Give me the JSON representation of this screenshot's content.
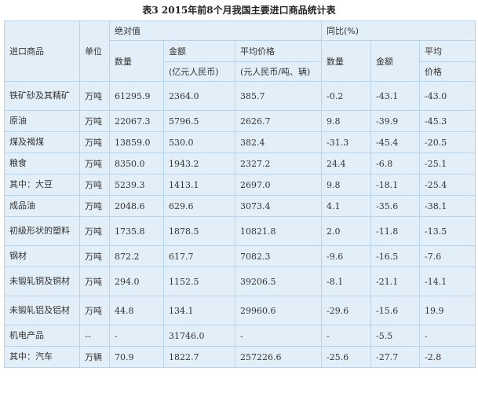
{
  "title": "表3 2015年前8个月我国主要进口商品统计表",
  "header": {
    "commodity": "进口商品",
    "unit": "单位",
    "absolute": "绝对值",
    "yoy": "同比(%)",
    "qty": "数量",
    "amount": "金额",
    "amount_unit": "(亿元人民币)",
    "avg_price": "平均价格",
    "avg_price_unit": "(元人民币/吨、辆)",
    "yoy_qty": "数量",
    "yoy_amount": "金额",
    "yoy_avg_1": "平均",
    "yoy_avg_2": "价格"
  },
  "rows": [
    {
      "name": "铁矿砂及其精矿",
      "unit": "万吨",
      "qty": "61295.9",
      "amount": "2364.0",
      "price": "385.7",
      "yoy_qty": "-0.2",
      "yoy_amount": "-43.1",
      "yoy_price": "-43.0"
    },
    {
      "name": "原油",
      "unit": "万吨",
      "qty": "22067.3",
      "amount": "5796.5",
      "price": "2626.7",
      "yoy_qty": "9.8",
      "yoy_amount": "-39.9",
      "yoy_price": "-45.3"
    },
    {
      "name": "煤及褐煤",
      "unit": "万吨",
      "qty": "13859.0",
      "amount": "530.0",
      "price": "382.4",
      "yoy_qty": "-31.3",
      "yoy_amount": "-45.4",
      "yoy_price": "-20.5"
    },
    {
      "name": "粮食",
      "unit": "万吨",
      "qty": "8350.0",
      "amount": "1943.2",
      "price": "2327.2",
      "yoy_qty": "24.4",
      "yoy_amount": "-6.8",
      "yoy_price": "-25.1"
    },
    {
      "name": "其中：大豆",
      "unit": "万吨",
      "qty": "5239.3",
      "amount": "1413.1",
      "price": "2697.0",
      "yoy_qty": "9.8",
      "yoy_amount": "-18.1",
      "yoy_price": "-25.4"
    },
    {
      "name": "成品油",
      "unit": "万吨",
      "qty": "2048.6",
      "amount": "629.6",
      "price": "3073.4",
      "yoy_qty": "4.1",
      "yoy_amount": "-35.6",
      "yoy_price": "-38.1"
    },
    {
      "name": "初级形状的塑料",
      "unit": "万吨",
      "qty": "1735.8",
      "amount": "1878.5",
      "price": "10821.8",
      "yoy_qty": "2.0",
      "yoy_amount": "-11.8",
      "yoy_price": "-13.5"
    },
    {
      "name": "钢材",
      "unit": "万吨",
      "qty": "872.2",
      "amount": "617.7",
      "price": "7082.3",
      "yoy_qty": "-9.6",
      "yoy_amount": "-16.5",
      "yoy_price": "-7.6"
    },
    {
      "name": "未锻轧铜及铜材",
      "unit": "万吨",
      "qty": "294.0",
      "amount": "1152.5",
      "price": "39206.5",
      "yoy_qty": "-8.1",
      "yoy_amount": "-21.1",
      "yoy_price": "-14.1"
    },
    {
      "name": "未锻轧铝及铝材",
      "unit": "万吨",
      "qty": "44.8",
      "amount": "134.1",
      "price": "29960.6",
      "yoy_qty": "-29.6",
      "yoy_amount": "-15.6",
      "yoy_price": "19.9"
    },
    {
      "name": "机电产品",
      "unit": "--",
      "qty": "-",
      "amount": "31746.0",
      "price": "-",
      "yoy_qty": "-",
      "yoy_amount": "-5.5",
      "yoy_price": "-"
    },
    {
      "name": "其中：汽车",
      "unit": "万辆",
      "qty": "70.9",
      "amount": "1822.7",
      "price": "257226.6",
      "yoy_qty": "-25.6",
      "yoy_amount": "-27.7",
      "yoy_price": "-2.8"
    }
  ]
}
